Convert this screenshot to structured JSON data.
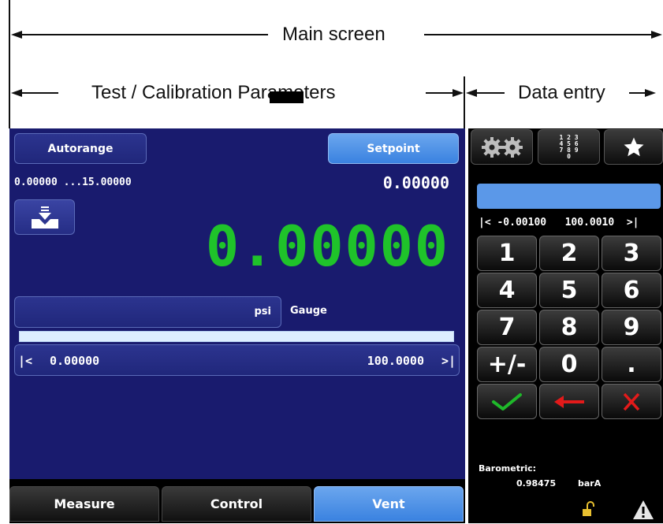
{
  "annotations": {
    "main_screen": "Main screen",
    "test_calibration": "Test / Calibration Parameters",
    "data_entry": "Data entry"
  },
  "left": {
    "autorange_label": "Autorange",
    "setpoint_label": "Setpoint",
    "range_text": "0.00000 ...15.00000",
    "setpoint_value": "0.00000",
    "main_value": "0.00000",
    "unit": "psi",
    "mode": "Gauge",
    "bar_min_marker": "|<",
    "bar_min": "0.00000",
    "bar_max": "100.0000",
    "bar_max_marker": ">|"
  },
  "tabs": [
    {
      "label": "Measure"
    },
    {
      "label": "Control"
    },
    {
      "label": "Vent"
    }
  ],
  "keypad": {
    "top_icons": [
      "gears-icon",
      "numpad-icon",
      "star-icon"
    ],
    "numpad_icon_text": "1 2 3\n4 5 6\n7 8 9\n0",
    "range_text": "|< -0.00100   100.0010  >|",
    "keys": [
      "1",
      "2",
      "3",
      "4",
      "5",
      "6",
      "7",
      "8",
      "9",
      "+/-",
      "0",
      "."
    ],
    "confirm_color": "#1fb82a",
    "backspace_color": "#e31a1a",
    "cancel_color": "#e31a1a"
  },
  "barometric": {
    "label": "Barometric:",
    "value": "0.98475",
    "unit": "barA"
  },
  "colors": {
    "screen_bg": "#191b6e",
    "accent_blue": "#4a90e6",
    "value_green": "#1fc32a"
  }
}
